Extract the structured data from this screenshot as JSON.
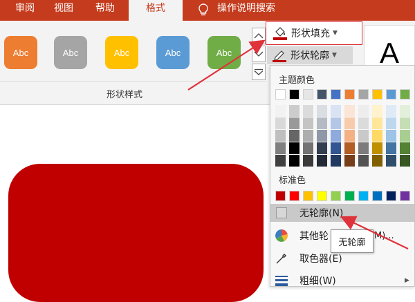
{
  "tabs": {
    "review": "审阅",
    "view": "视图",
    "help": "帮助",
    "format": "格式",
    "search_hint": "操作说明搜索"
  },
  "ribbon": {
    "style_buttons": [
      {
        "label": "Abc",
        "color": "#ed7d31"
      },
      {
        "label": "Abc",
        "color": "#a5a5a5"
      },
      {
        "label": "Abc",
        "color": "#ffc000"
      },
      {
        "label": "Abc",
        "color": "#5b9bd5"
      },
      {
        "label": "Abc",
        "color": "#70ad47"
      }
    ],
    "group_label": "形状样式",
    "fill_label": "形状填充",
    "outline_label": "形状轮廓",
    "wordart_letter": "A",
    "accent_color": "#c43b1d",
    "fill_color": "#c00000"
  },
  "dropdown": {
    "theme_colors_title": "主题颜色",
    "theme_colors": [
      "#ffffff",
      "#000000",
      "#e7e6e6",
      "#44546a",
      "#4472c4",
      "#ed7d31",
      "#a5a5a5",
      "#ffc000",
      "#5b9bd5",
      "#70ad47"
    ],
    "standard_colors_title": "标准色",
    "standard_colors": [
      "#c00000",
      "#ff0000",
      "#ffc000",
      "#ffff00",
      "#92d050",
      "#00b050",
      "#00b0f0",
      "#0070c0",
      "#002060",
      "#7030a0"
    ],
    "menu": {
      "no_outline": "无轮廓(N)",
      "other_colors": "其他轮",
      "other_colors_tail": "M)...",
      "eyedropper": "取色器(E)",
      "weight": "粗细(W)"
    }
  },
  "tooltip": "无轮廓"
}
